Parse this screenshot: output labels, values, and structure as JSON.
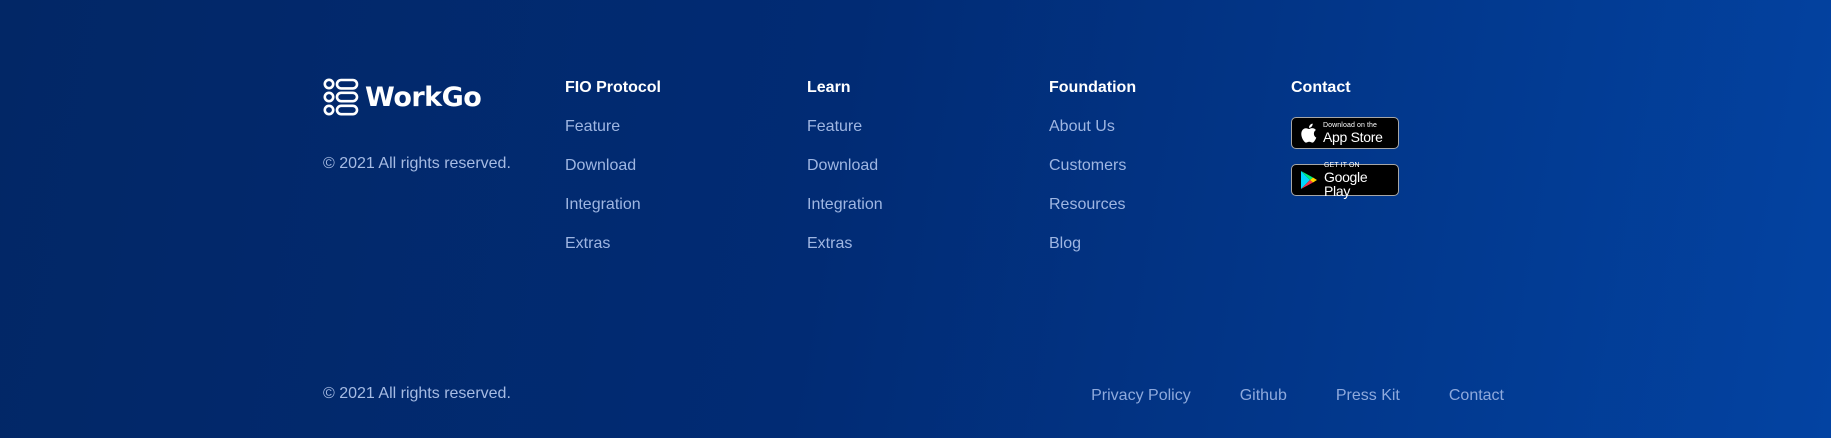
{
  "brand": {
    "name": "WorkGo",
    "copyright": "© 2021 All rights reserved."
  },
  "columns": [
    {
      "title": "FIO Protocol",
      "links": [
        "Feature",
        "Download",
        "Integration",
        "Extras"
      ]
    },
    {
      "title": "Learn",
      "links": [
        "Feature",
        "Download",
        "Integration",
        "Extras"
      ]
    },
    {
      "title": "Foundation",
      "links": [
        "About Us",
        "Customers",
        "Resources",
        "Blog"
      ]
    }
  ],
  "contact": {
    "title": "Contact",
    "app_store": {
      "small": "Download on the",
      "big": "App Store",
      "icon": "apple-icon"
    },
    "google_play": {
      "small": "GET IT ON",
      "big": "Google Play",
      "icon": "google-play-icon"
    }
  },
  "bottom": {
    "copyright": "© 2021 All rights reserved.",
    "links": [
      "Privacy Policy",
      "Github",
      "Press Kit",
      "Contact"
    ]
  },
  "colors": {
    "background_start": "#022766",
    "background_end": "#0343a2",
    "heading": "#ffffff",
    "link": "#9fb6e2"
  }
}
